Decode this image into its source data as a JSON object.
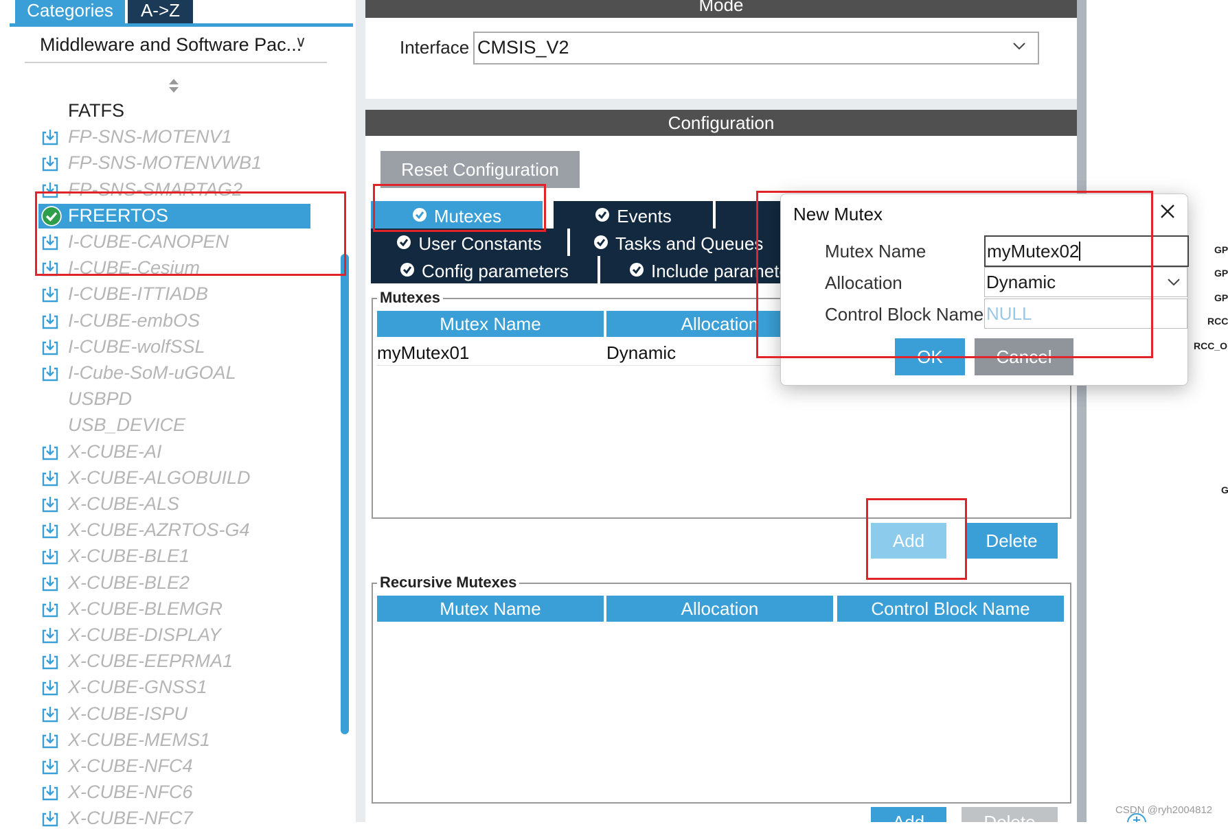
{
  "left_panel": {
    "tabs": [
      "Categories",
      "A->Z"
    ],
    "category_select": "Middleware and Software Pac...",
    "packages": [
      {
        "label": "FATFS",
        "style": "normal",
        "icon": "none"
      },
      {
        "label": "FP-SNS-MOTENV1",
        "style": "disabled",
        "icon": "download-icon"
      },
      {
        "label": "FP-SNS-MOTENVWB1",
        "style": "disabled",
        "icon": "download-icon"
      },
      {
        "label": "FP-SNS-SMARTAG2",
        "style": "disabled",
        "icon": "download-icon"
      },
      {
        "label": "FREERTOS",
        "style": "selected",
        "icon": "check-circle-icon"
      },
      {
        "label": "I-CUBE-CANOPEN",
        "style": "disabled",
        "icon": "download-icon"
      },
      {
        "label": "I-CUBE-Cesium",
        "style": "disabled",
        "icon": "download-icon"
      },
      {
        "label": "I-CUBE-ITTIADB",
        "style": "disabled",
        "icon": "download-icon"
      },
      {
        "label": "I-CUBE-embOS",
        "style": "disabled",
        "icon": "download-icon"
      },
      {
        "label": "I-CUBE-wolfSSL",
        "style": "disabled",
        "icon": "download-icon"
      },
      {
        "label": "I-Cube-SoM-uGOAL",
        "style": "disabled",
        "icon": "download-icon"
      },
      {
        "label": "USBPD",
        "style": "disabled",
        "icon": "none"
      },
      {
        "label": "USB_DEVICE",
        "style": "disabled",
        "icon": "none"
      },
      {
        "label": "X-CUBE-AI",
        "style": "disabled",
        "icon": "download-icon"
      },
      {
        "label": "X-CUBE-ALGOBUILD",
        "style": "disabled",
        "icon": "download-icon"
      },
      {
        "label": "X-CUBE-ALS",
        "style": "disabled",
        "icon": "download-icon"
      },
      {
        "label": "X-CUBE-AZRTOS-G4",
        "style": "disabled",
        "icon": "download-icon"
      },
      {
        "label": "X-CUBE-BLE1",
        "style": "disabled",
        "icon": "download-icon"
      },
      {
        "label": "X-CUBE-BLE2",
        "style": "disabled",
        "icon": "download-icon"
      },
      {
        "label": "X-CUBE-BLEMGR",
        "style": "disabled",
        "icon": "download-icon"
      },
      {
        "label": "X-CUBE-DISPLAY",
        "style": "disabled",
        "icon": "download-icon"
      },
      {
        "label": "X-CUBE-EEPRMA1",
        "style": "disabled",
        "icon": "download-icon"
      },
      {
        "label": "X-CUBE-GNSS1",
        "style": "disabled",
        "icon": "download-icon"
      },
      {
        "label": "X-CUBE-ISPU",
        "style": "disabled",
        "icon": "download-icon"
      },
      {
        "label": "X-CUBE-MEMS1",
        "style": "disabled",
        "icon": "download-icon"
      },
      {
        "label": "X-CUBE-NFC4",
        "style": "disabled",
        "icon": "download-icon"
      },
      {
        "label": "X-CUBE-NFC6",
        "style": "disabled",
        "icon": "download-icon"
      },
      {
        "label": "X-CUBE-NFC7",
        "style": "disabled",
        "icon": "download-icon"
      }
    ]
  },
  "mode": {
    "title": "Mode",
    "interface_label": "Interface",
    "interface_value": "CMSIS_V2"
  },
  "configuration": {
    "title": "Configuration",
    "reset_label": "Reset Configuration",
    "tabs_row1": [
      "Mutexes",
      "Events"
    ],
    "tabs_row2": [
      "User Constants",
      "Tasks and Queues"
    ],
    "tabs_row3": [
      "Config parameters",
      "Include parameters"
    ],
    "mutexes": {
      "title": "Mutexes",
      "columns": [
        "Mutex Name",
        "Allocation"
      ],
      "rows": [
        [
          "myMutex01",
          "Dynamic"
        ]
      ],
      "add_label": "Add",
      "delete_label": "Delete"
    },
    "recursive_mutexes": {
      "title": "Recursive Mutexes",
      "columns": [
        "Mutex Name",
        "Allocation",
        "Control Block Name"
      ],
      "add_label": "Add",
      "delete_label": "Delete"
    }
  },
  "dialog": {
    "title": "New Mutex",
    "name_label": "Mutex Name",
    "name_value": "myMutex02",
    "allocation_label": "Allocation",
    "allocation_value": "Dynamic",
    "cb_label": "Control Block Name",
    "cb_placeholder": "NULL",
    "ok_label": "OK",
    "cancel_label": "Cancel"
  },
  "right_strip": {
    "pins": [
      "GP",
      "GP",
      "GP",
      "RCC",
      "RCC_O",
      "G"
    ],
    "watermark": "CSDN @ryh2004812"
  },
  "colors": {
    "accent": "#3a9fd6",
    "dark_tab": "#12293f",
    "header_bar": "#505050",
    "annotation_red": "#e0242a"
  }
}
